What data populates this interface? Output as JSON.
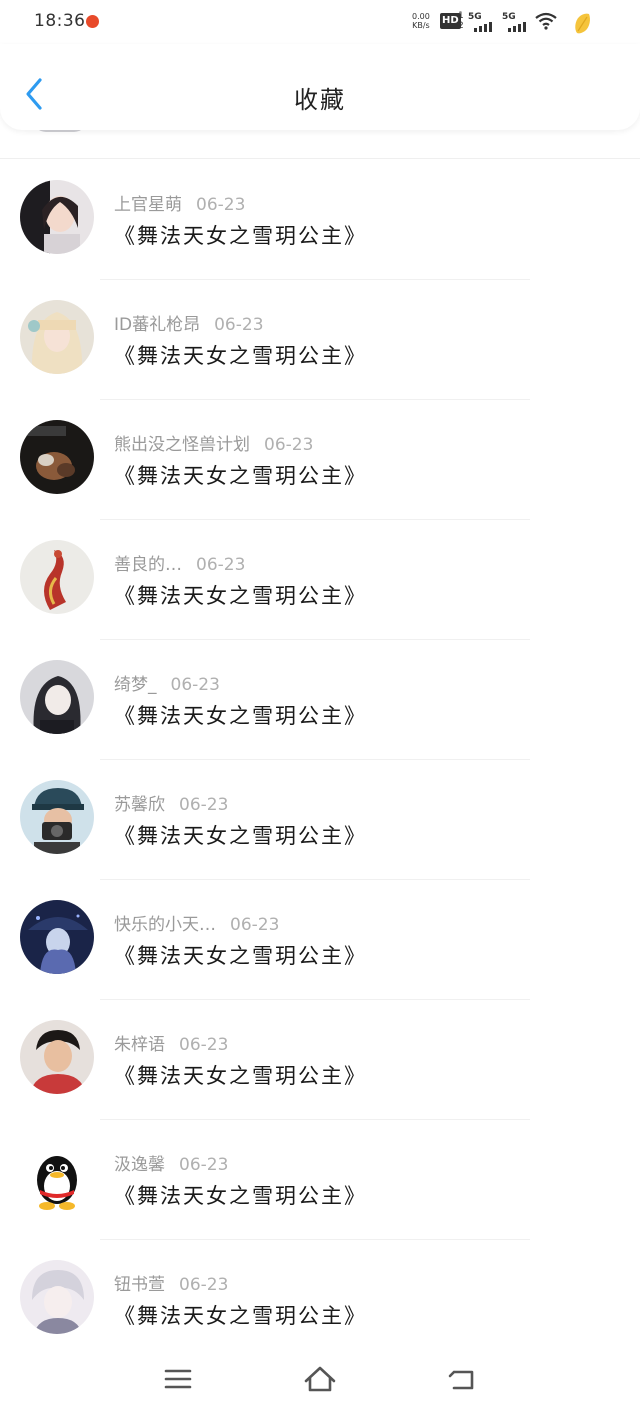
{
  "status_bar": {
    "time": "18:36",
    "net_speed_value": "0.00",
    "net_speed_unit": "KB/s",
    "hd_label": "HD",
    "sim_1": "1",
    "sim_2": "2",
    "signal_1_label": "5G",
    "signal_2_label": "5G"
  },
  "header": {
    "title": "收藏",
    "accent_color": "#2e9bf0"
  },
  "favorites": [
    {
      "user": "上官星萌",
      "date": "06-23",
      "title": "《舞法天女之雪玥公主》"
    },
    {
      "user": "ID蕃礼枪昂",
      "date": "06-23",
      "title": "《舞法天女之雪玥公主》"
    },
    {
      "user": "熊出没之怪兽计划",
      "date": "06-23",
      "title": "《舞法天女之雪玥公主》"
    },
    {
      "user": "善良的…",
      "date": "06-23",
      "title": "《舞法天女之雪玥公主》"
    },
    {
      "user": "绮梦_",
      "date": "06-23",
      "title": "《舞法天女之雪玥公主》"
    },
    {
      "user": "苏馨欣",
      "date": "06-23",
      "title": "《舞法天女之雪玥公主》"
    },
    {
      "user": "快乐的小天…",
      "date": "06-23",
      "title": "《舞法天女之雪玥公主》"
    },
    {
      "user": "朱梓语",
      "date": "06-23",
      "title": "《舞法天女之雪玥公主》"
    },
    {
      "user": "汲逸馨",
      "date": "06-23",
      "title": "《舞法天女之雪玥公主》"
    },
    {
      "user": "钮书萱",
      "date": "06-23",
      "title": "《舞法天女之雪玥公主》"
    }
  ],
  "nav_bar": {
    "icons": [
      "menu-icon",
      "home-icon",
      "back-icon"
    ]
  }
}
